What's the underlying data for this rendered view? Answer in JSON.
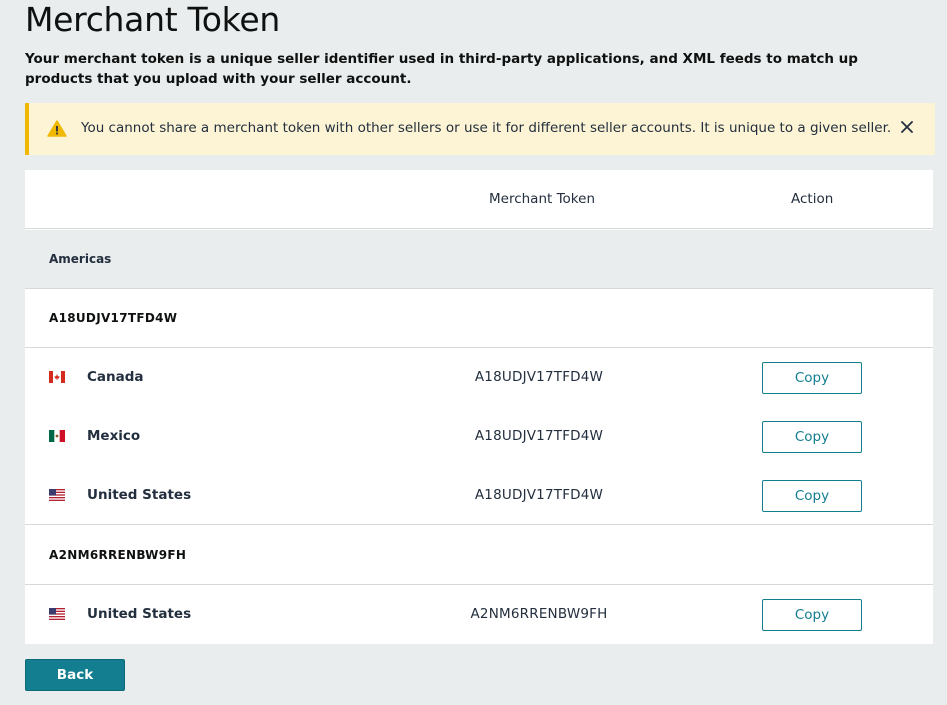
{
  "page": {
    "title": "Merchant Token",
    "description": "Your merchant token is a unique seller identifier used in third-party applications, and XML feeds to match up products that you upload with your seller account."
  },
  "alert": {
    "text": "You cannot share a merchant token with other sellers or use it for different seller accounts. It is unique to a given seller.",
    "icon": "warning-icon",
    "close_icon": "close-icon"
  },
  "table": {
    "headers": {
      "token": "Merchant Token",
      "action": "Action"
    },
    "region": "Americas",
    "groups": [
      {
        "token": "A18UDJV17TFD4W",
        "markets": [
          {
            "name": "Canada",
            "flag": "canada-flag-icon",
            "token": "A18UDJV17TFD4W",
            "action": "Copy"
          },
          {
            "name": "Mexico",
            "flag": "mexico-flag-icon",
            "token": "A18UDJV17TFD4W",
            "action": "Copy"
          },
          {
            "name": "United States",
            "flag": "us-flag-icon",
            "token": "A18UDJV17TFD4W",
            "action": "Copy"
          }
        ]
      },
      {
        "token": "A2NM6RRENBW9FH",
        "markets": [
          {
            "name": "United States",
            "flag": "us-flag-icon",
            "token": "A2NM6RRENBW9FH",
            "action": "Copy"
          }
        ]
      }
    ]
  },
  "footer": {
    "back_label": "Back"
  },
  "colors": {
    "accent": "#127e8f",
    "alert_border": "#f0b800",
    "alert_bg": "#fcf4d4",
    "page_bg": "#eaeded"
  }
}
